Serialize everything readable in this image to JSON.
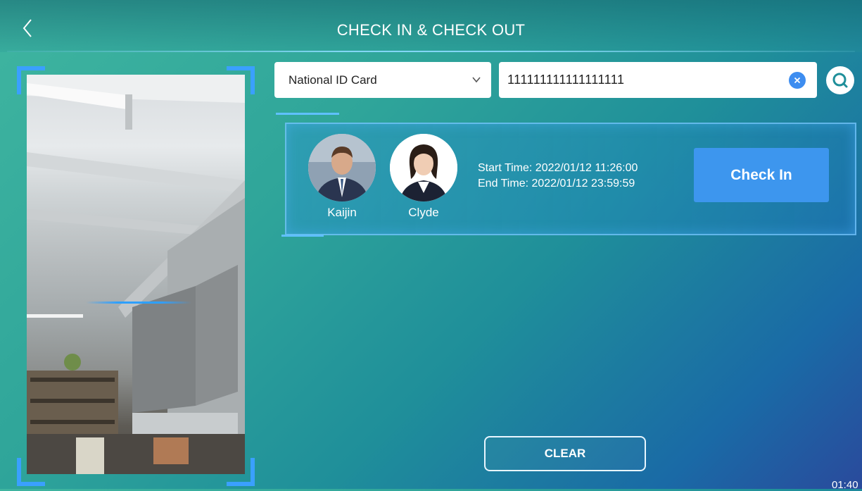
{
  "header": {
    "title": "CHECK IN & CHECK OUT",
    "back_icon": "chevron-left-icon"
  },
  "camera": {
    "scan_color": "#2ea0ff",
    "frame_color": "#3aa0ff"
  },
  "search": {
    "id_type": "National ID Card",
    "id_value": "111111111111111111",
    "clear_icon": "close-circle-icon",
    "search_icon": "search-icon"
  },
  "result": {
    "people": [
      {
        "name": "Kaijin"
      },
      {
        "name": "Clyde"
      }
    ],
    "start_time": "Start Time: 2022/01/12 11:26:00",
    "end_time": "End Time: 2022/01/12 23:59:59",
    "action_label": "Check In",
    "action_color": "#3d96ee"
  },
  "footer": {
    "clear_label": "CLEAR",
    "clock": "01:40"
  }
}
